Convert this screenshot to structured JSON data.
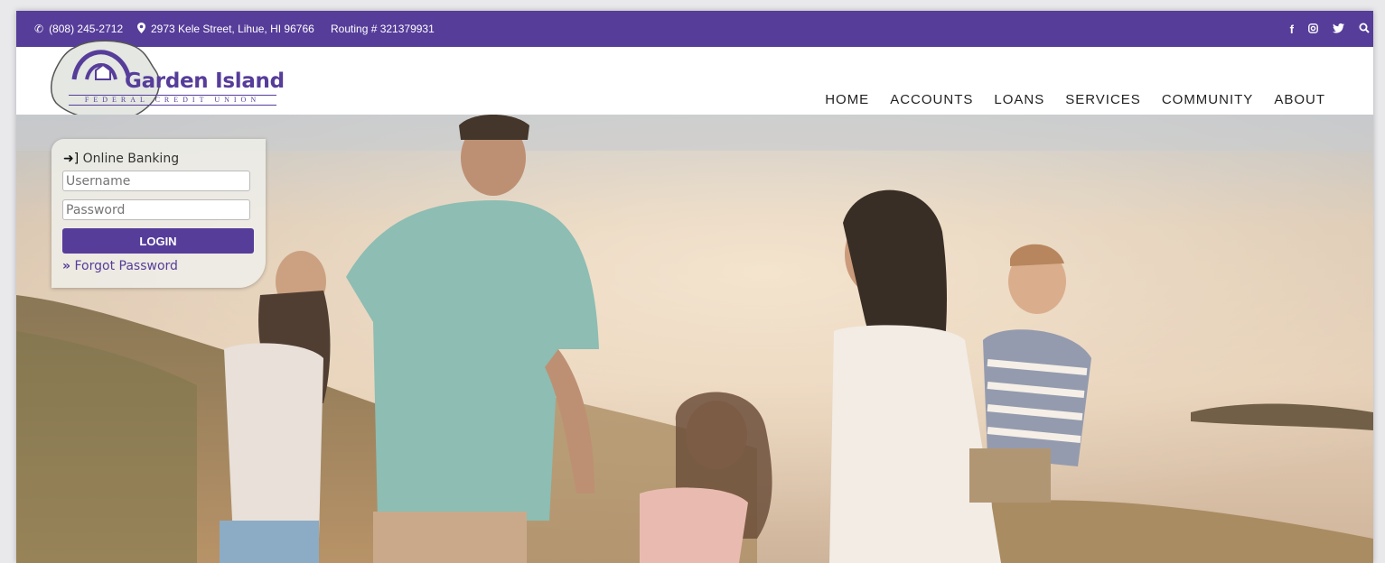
{
  "topbar": {
    "phone": "(808) 245-2712",
    "address": "2973 Kele Street, Lihue, HI 96766",
    "routing": "Routing # 321379931",
    "icons": [
      "phone-icon",
      "map-marker-icon",
      "facebook-icon",
      "instagram-icon",
      "twitter-icon",
      "search-icon"
    ]
  },
  "logo": {
    "title": "Garden Island",
    "subtitle": "FEDERAL CREDIT UNION"
  },
  "nav": {
    "items": [
      {
        "label": "HOME"
      },
      {
        "label": "ACCOUNTS"
      },
      {
        "label": "LOANS"
      },
      {
        "label": "SERVICES"
      },
      {
        "label": "COMMUNITY"
      },
      {
        "label": "ABOUT"
      }
    ]
  },
  "login": {
    "title": "Online Banking",
    "username_placeholder": "Username",
    "password_placeholder": "Password",
    "button_label": "LOGIN",
    "forgot_label": "Forgot Password"
  },
  "colors": {
    "brand": "#563d9a",
    "topbar_text": "#ffffff"
  }
}
